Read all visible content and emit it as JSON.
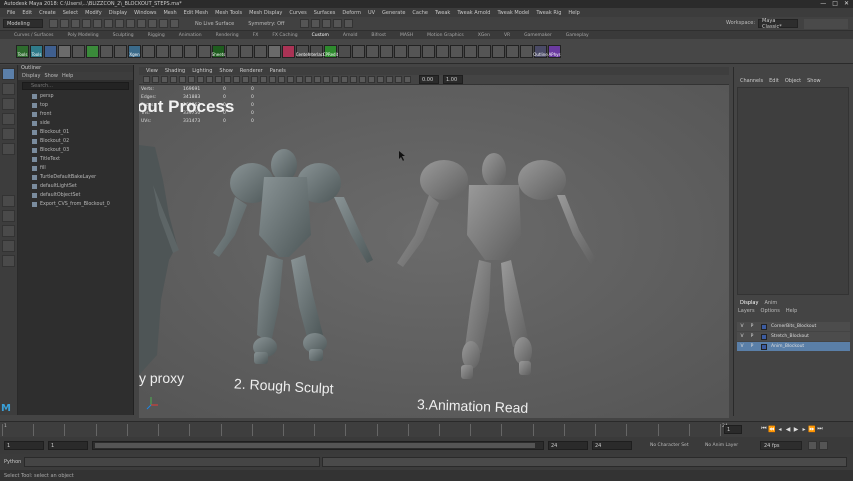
{
  "window": {
    "title": "Autodesk Maya 2018: C:\\Users\\...\\BLIZZCON_2\\_BLOCKOUT_STEPS.ma*",
    "controls": [
      "—",
      "□",
      "✕"
    ]
  },
  "menubar": [
    "File",
    "Edit",
    "Create",
    "Select",
    "Modify",
    "Display",
    "Windows",
    "Mesh",
    "Edit Mesh",
    "Mesh Tools",
    "Mesh Display",
    "Curves",
    "Surfaces",
    "Deform",
    "UV",
    "Generate",
    "Cache",
    "Tweak",
    "Tweak Arnold",
    "Tweak Model",
    "Tweak Rig",
    "Help"
  ],
  "statusline": {
    "mode": "Modeling",
    "no_live_surface": "No Live Surface",
    "symmetry": "Symmetry: Off",
    "workspace_label": "Workspace:",
    "workspace_value": "Maya Classic*"
  },
  "shelf": {
    "tabs": [
      "Curves / Surfaces",
      "Poly Modeling",
      "Sculpting",
      "Rigging",
      "Animation",
      "Rendering",
      "FX",
      "FX Caching",
      "Custom",
      "Arnold",
      "Bifrost",
      "MASH",
      "Motion Graphics",
      "XGen",
      "VR",
      "Gamemaker",
      "Gameplay"
    ],
    "active_tab": "Custom",
    "buttons": [
      {
        "label": "Tools",
        "color": "#2e6b2e"
      },
      {
        "label": "Tools",
        "color": "#2f7b8a"
      },
      {
        "label": "",
        "color": "#3f5f8f"
      },
      {
        "label": "",
        "color": "#6b6b6b"
      },
      {
        "label": "",
        "color": "#555"
      },
      {
        "label": "",
        "color": "#3a8a3a"
      },
      {
        "label": "",
        "color": "#555"
      },
      {
        "label": "",
        "color": "#555"
      },
      {
        "label": "Xgen",
        "color": "#3a6a8a"
      },
      {
        "label": "",
        "color": "#555"
      },
      {
        "label": "",
        "color": "#555"
      },
      {
        "label": "",
        "color": "#555"
      },
      {
        "label": "",
        "color": "#555"
      },
      {
        "label": "",
        "color": "#555"
      },
      {
        "label": "Sheets",
        "color": "#1e5c1e"
      },
      {
        "label": "",
        "color": "#555"
      },
      {
        "label": "",
        "color": "#555"
      },
      {
        "label": "",
        "color": "#555"
      },
      {
        "label": "",
        "color": "#6a6a6a"
      },
      {
        "label": "",
        "color": "#aa3355"
      },
      {
        "label": "Center",
        "color": "#4d4d4d"
      },
      {
        "label": "Interlace",
        "color": "#4d4d4d"
      },
      {
        "label": "CPRedit",
        "color": "#2e8a2e"
      },
      {
        "label": "",
        "color": "#4d4d4d"
      },
      {
        "label": "",
        "color": "#555"
      },
      {
        "label": "",
        "color": "#555"
      },
      {
        "label": "",
        "color": "#555"
      },
      {
        "label": "",
        "color": "#555"
      },
      {
        "label": "",
        "color": "#555"
      },
      {
        "label": "",
        "color": "#555"
      },
      {
        "label": "",
        "color": "#555"
      },
      {
        "label": "",
        "color": "#555"
      },
      {
        "label": "",
        "color": "#555"
      },
      {
        "label": "",
        "color": "#555"
      },
      {
        "label": "",
        "color": "#555"
      },
      {
        "label": "",
        "color": "#555"
      },
      {
        "label": "",
        "color": "#555"
      },
      {
        "label": "Outline",
        "color": "#4a4a66"
      },
      {
        "label": "APhys",
        "color": "#6a3aa0"
      }
    ]
  },
  "outliner": {
    "title": "Outliner",
    "menu": [
      "Display",
      "Show",
      "Help"
    ],
    "search_placeholder": "Search...",
    "items": [
      "persp",
      "top",
      "front",
      "side",
      "Blockout_01",
      "Blockout_02",
      "Blockout_03",
      "TitleText",
      "fill",
      "TurtleDefaultBakeLayer",
      "defaultLightSet",
      "defaultObjectSet",
      "Export_CVS_from_Blockout_0"
    ]
  },
  "viewport": {
    "menu": [
      "View",
      "Shading",
      "Lighting",
      "Show",
      "Renderer",
      "Panels"
    ],
    "field_a": "0.00",
    "field_b": "1.00",
    "hud": [
      {
        "label": "Verts:",
        "value": "169691",
        "sel": "0",
        "extra": "0"
      },
      {
        "label": "Edges:",
        "value": "341883",
        "sel": "0",
        "extra": "0"
      },
      {
        "label": "Faces:",
        "value": "169863",
        "sel": "0",
        "extra": "0"
      },
      {
        "label": "Tris:",
        "value": "339750",
        "sel": "0",
        "extra": "0"
      },
      {
        "label": "UVs:",
        "value": "331473",
        "sel": "0",
        "extra": "0"
      }
    ],
    "banner": "out Process",
    "captions": [
      "y proxy",
      "2. Rough Sculpt",
      "3.Animation Read"
    ]
  },
  "channelbox": {
    "tabs": [
      "Channels",
      "Edit",
      "Object",
      "Show"
    ]
  },
  "layers": {
    "tabs": [
      "Display",
      "Anim"
    ],
    "menu": [
      "Layers",
      "Options",
      "Help"
    ],
    "rows": [
      {
        "v": "V",
        "p": "P",
        "name": "CornerBits_Blockout",
        "color": "#3b5ba0",
        "selected": false
      },
      {
        "v": "V",
        "p": "P",
        "name": "Stretch_Blockout",
        "color": "#3b5ba0",
        "selected": false
      },
      {
        "v": "V",
        "p": "P",
        "name": "Anim_Blockout",
        "color": "#3b5ba0",
        "selected": true
      }
    ]
  },
  "timeline": {
    "ticks": [
      "1",
      "",
      "",
      "",
      "",
      "",
      "",
      "",
      "",
      "",
      "",
      "",
      "",
      "",
      "",
      "",
      "",
      "",
      "",
      "",
      "",
      "",
      "",
      "24"
    ],
    "current_frame": "1",
    "range_start": "1",
    "range_start2": "1",
    "range_end": "24",
    "range_end2": "24",
    "anim_end": "24",
    "character_set": "No Character Set",
    "anim_layer": "No Anim Layer",
    "fps": "24 fps"
  },
  "command": {
    "lang": "Python",
    "help": "Select Tool: select an object"
  }
}
